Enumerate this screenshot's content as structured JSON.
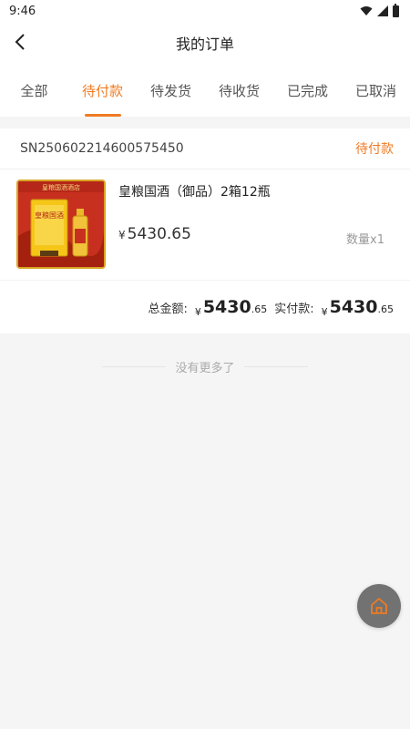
{
  "status_bar": {
    "time": "9:46"
  },
  "header": {
    "title": "我的订单"
  },
  "tabs": [
    {
      "label": "全部",
      "active": false
    },
    {
      "label": "待付款",
      "active": true
    },
    {
      "label": "待发货",
      "active": false
    },
    {
      "label": "待收货",
      "active": false
    },
    {
      "label": "已完成",
      "active": false
    },
    {
      "label": "已取消",
      "active": false
    }
  ],
  "order": {
    "order_no": "SN250602214600575450",
    "status": "待付款",
    "product": {
      "name": "皇粮国酒（御品）2箱12瓶",
      "price_symbol": "¥",
      "price": "5430.65",
      "quantity": "数量x1",
      "image_label": "皇粮国酒"
    },
    "totals": {
      "total_label": "总金额:",
      "total_symbol": "¥",
      "total_int": "5430",
      "total_dec": ".65",
      "paid_label": "实付款:",
      "paid_symbol": "¥",
      "paid_int": "5430",
      "paid_dec": ".65"
    }
  },
  "list_end": {
    "text": "没有更多了"
  },
  "colors": {
    "accent": "#f07b22",
    "fab": "#727272"
  },
  "icons": {
    "back": "chevron-left-icon",
    "home": "home-icon"
  }
}
